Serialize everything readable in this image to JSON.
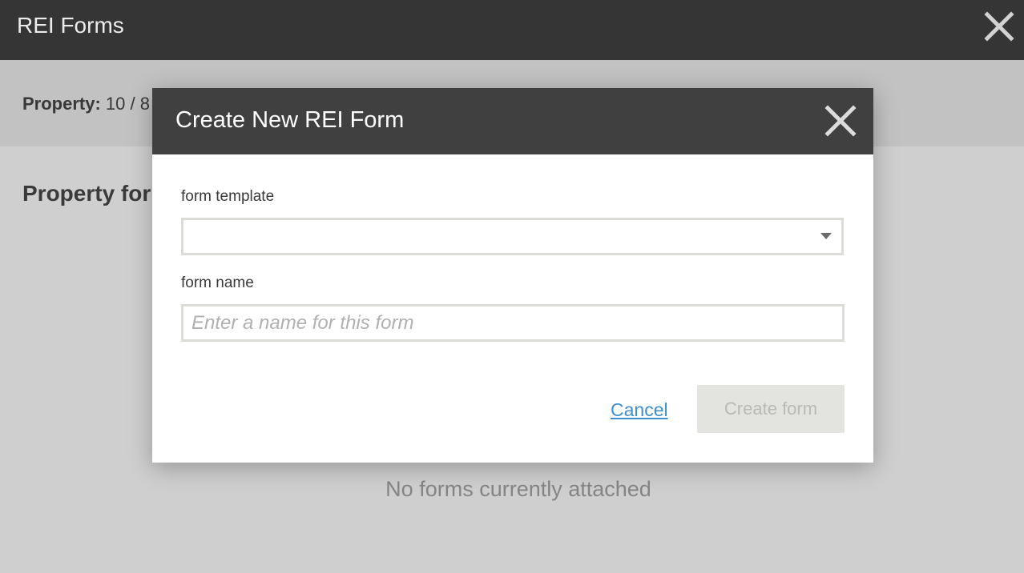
{
  "app": {
    "title": "REI Forms",
    "close_icon": "close-icon"
  },
  "property": {
    "label": "Property:",
    "value": "10 / 8"
  },
  "section": {
    "heading": "Property for"
  },
  "empty_state": {
    "message": "No forms currently attached"
  },
  "modal": {
    "title": "Create New REI Form",
    "close_icon": "close-icon",
    "form_template": {
      "label": "form template",
      "value": "",
      "icon": "chevron-down-icon"
    },
    "form_name": {
      "label": "form name",
      "value": "",
      "placeholder": "Enter a name for this form"
    },
    "cancel_label": "Cancel",
    "create_label": "Create form"
  },
  "colors": {
    "topbar": "#353535",
    "modal_header": "#404040",
    "link": "#3d8fd1",
    "disabled_button": "#e3e3df",
    "overlay": "#cfcfcf"
  }
}
